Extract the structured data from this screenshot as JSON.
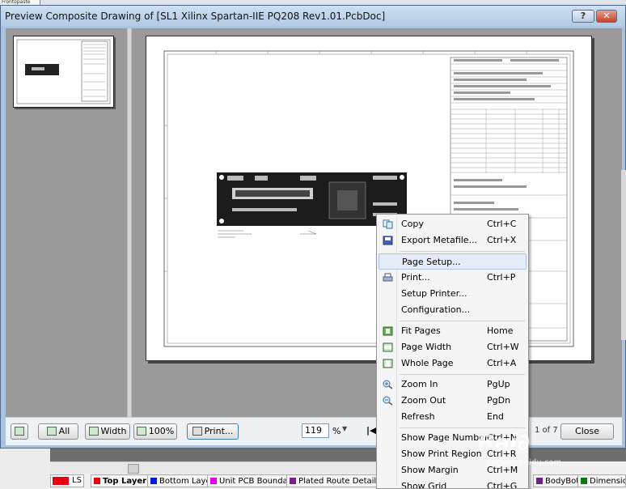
{
  "top_strip": {
    "tab_label": "Frontopaste"
  },
  "window": {
    "title": "Preview Composite Drawing of [SL1 Xilinx Spartan-IIE PQ208 Rev1.01.PcbDoc]",
    "help_label": "?",
    "close_label": "✕"
  },
  "toolbar": {
    "all_label": "All",
    "width_label": "Width",
    "zoom100_label": "100%",
    "print_label": "Print...",
    "zoom_value": "119",
    "zoom_unit": "%",
    "page_nav": "|◀",
    "page_counter": "1 of 7",
    "close_label": "Close"
  },
  "context_menu": {
    "items": [
      {
        "label": "Copy",
        "shortcut": "Ctrl+C",
        "icon": "copy-icon"
      },
      {
        "label": "Export Metafile...",
        "shortcut": "Ctrl+X",
        "icon": "save-icon"
      },
      {
        "label": "Page Setup...",
        "shortcut": "",
        "icon": ""
      },
      {
        "label": "Print...",
        "shortcut": "Ctrl+P",
        "icon": "printer-icon"
      },
      {
        "label": "Setup Printer...",
        "shortcut": "",
        "icon": ""
      },
      {
        "label": "Configuration...",
        "shortcut": "",
        "icon": ""
      },
      {
        "label": "Fit Pages",
        "shortcut": "Home",
        "icon": "fit-pages-icon"
      },
      {
        "label": "Page Width",
        "shortcut": "Ctrl+W",
        "icon": "page-width-icon"
      },
      {
        "label": "Whole Page",
        "shortcut": "Ctrl+A",
        "icon": "whole-page-icon"
      },
      {
        "label": "Zoom In",
        "shortcut": "PgUp",
        "icon": "zoom-in-icon"
      },
      {
        "label": "Zoom Out",
        "shortcut": "PgDn",
        "icon": "zoom-out-icon"
      },
      {
        "label": "Refresh",
        "shortcut": "End",
        "icon": ""
      },
      {
        "label": "Show Page Numbers",
        "shortcut": "Ctrl+N",
        "icon": ""
      },
      {
        "label": "Show Print Region",
        "shortcut": "Ctrl+R",
        "icon": ""
      },
      {
        "label": "Show Margin",
        "shortcut": "Ctrl+M",
        "icon": ""
      },
      {
        "label": "Show Grid",
        "shortcut": "Ctrl+G",
        "icon": ""
      }
    ]
  },
  "layer_tabs": {
    "ls_label": "LS",
    "tabs": [
      {
        "label": "Top Layer",
        "color": "#e8000b",
        "bold": true
      },
      {
        "label": "Bottom Layer",
        "color": "#0019e6"
      },
      {
        "label": "Unit PCB Boundary",
        "color": "#e600e6"
      },
      {
        "label": "Plated Route Details",
        "color": "#7a1f8e"
      },
      {
        "label": "BodyBot",
        "color": "#6b1e8c"
      },
      {
        "label": "Dimensions",
        "color": "#0a7a0a"
      }
    ]
  },
  "watermark": {
    "text": "Bai∂",
    "sub": "jingyan.baidu.com"
  },
  "colors": {
    "title_bar": "#b2c9e3",
    "highlight": "#e3ecf7",
    "pane_gray": "#9a9a9a"
  }
}
